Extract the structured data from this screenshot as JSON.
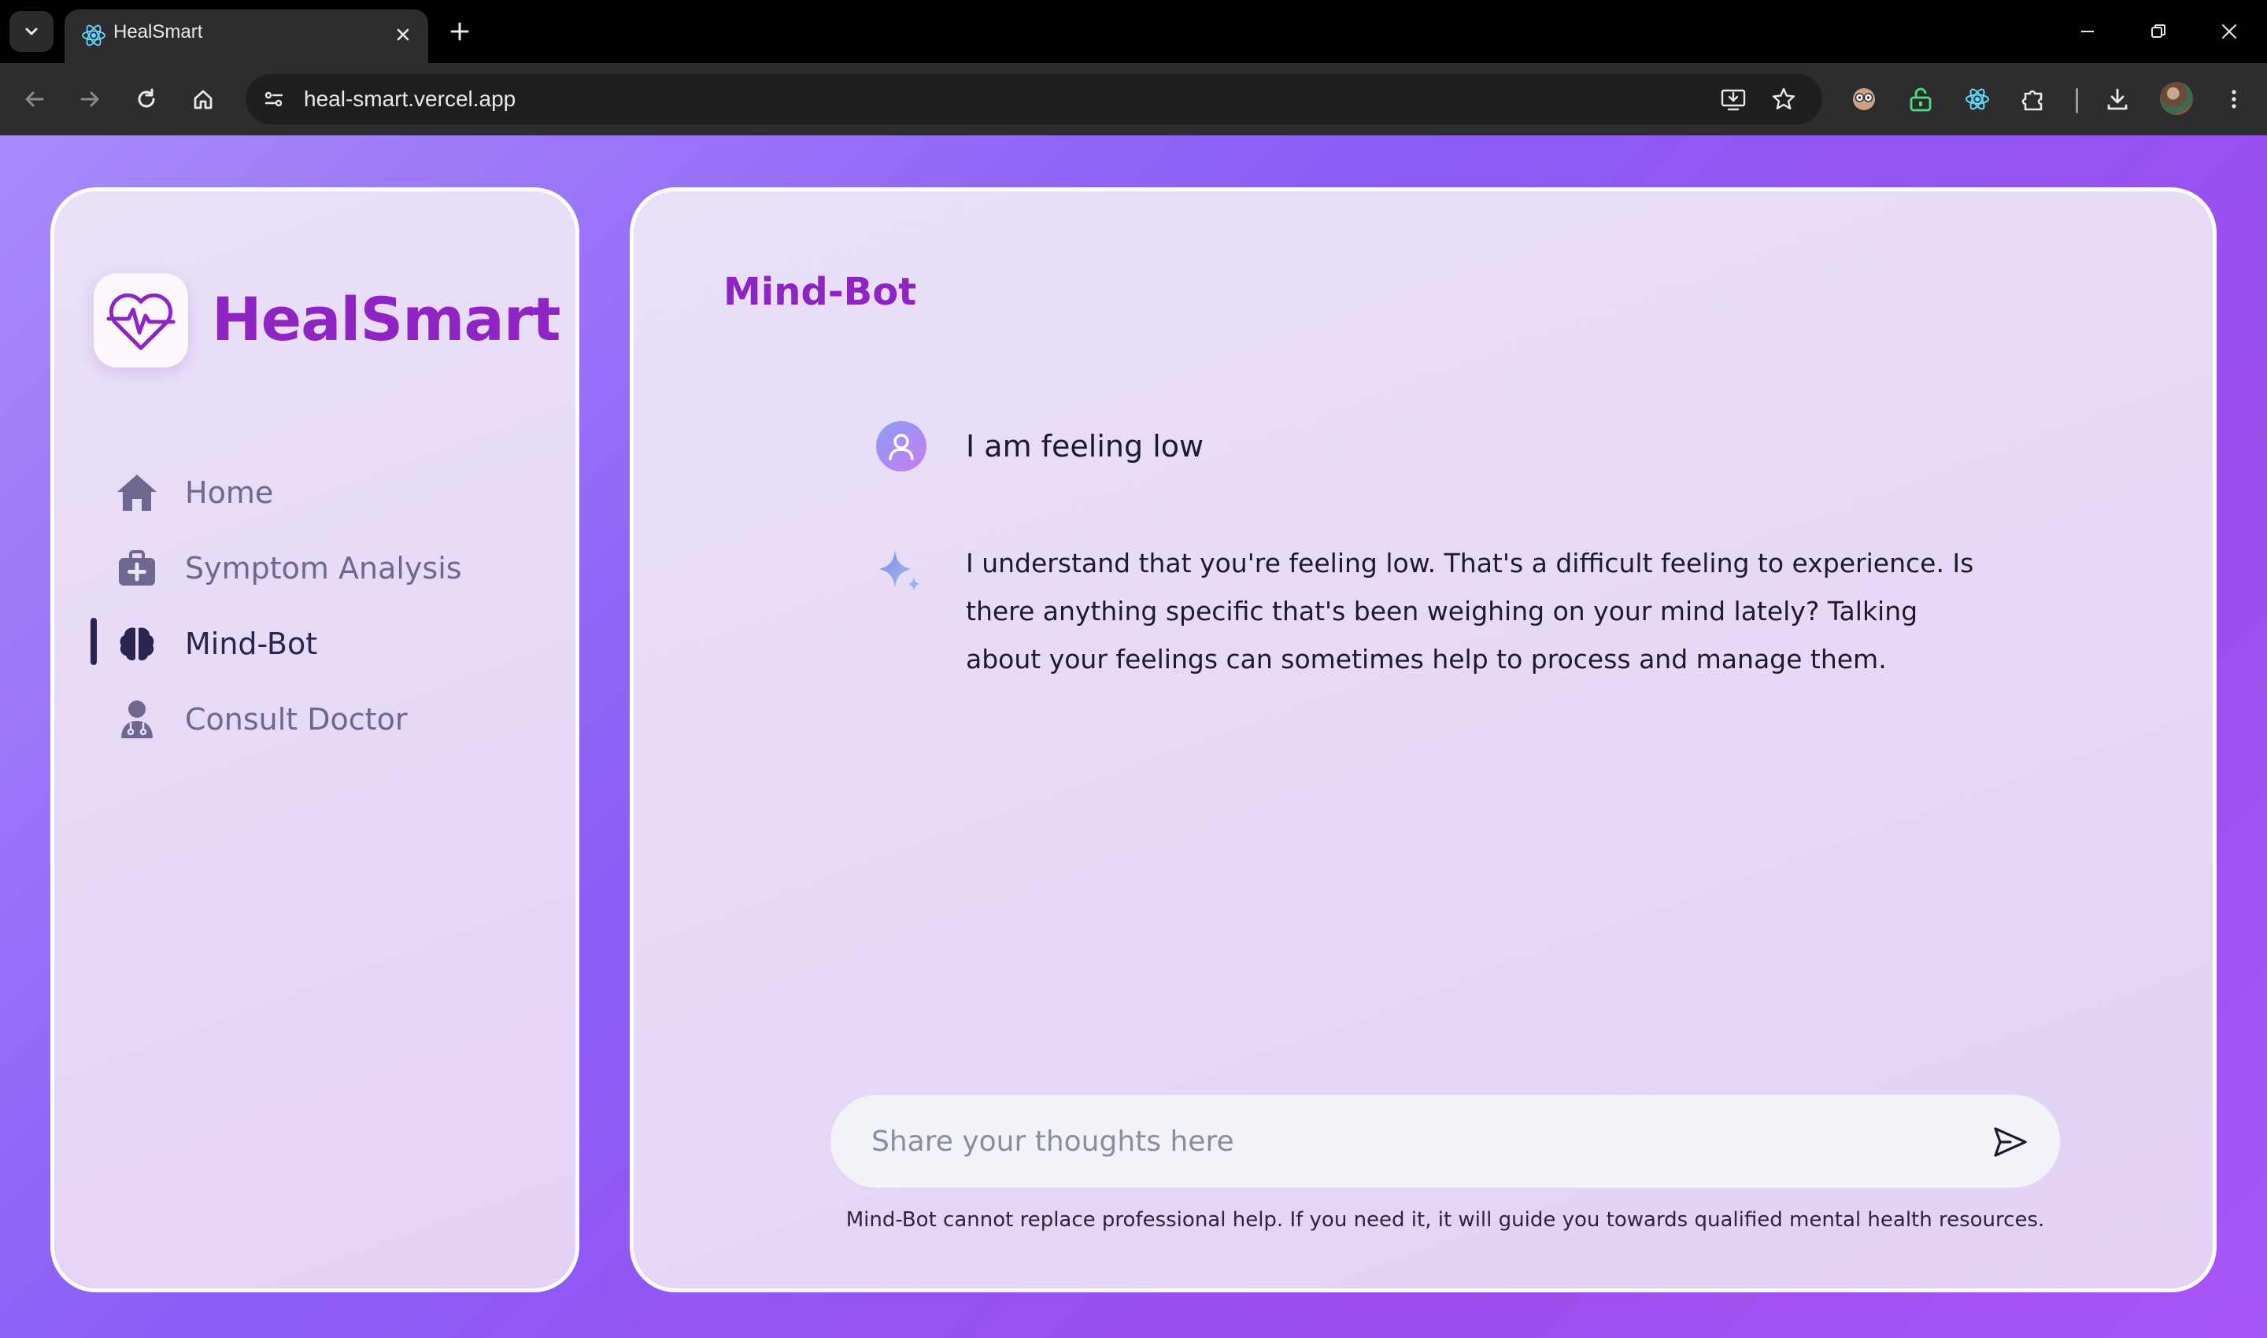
{
  "browser": {
    "tab_title": "HealSmart",
    "url": "heal-smart.vercel.app"
  },
  "app": {
    "brand": "HealSmart",
    "nav": [
      {
        "label": "Home",
        "icon": "home-icon",
        "active": false
      },
      {
        "label": "Symptom Analysis",
        "icon": "medical-kit-icon",
        "active": false
      },
      {
        "label": "Mind-Bot",
        "icon": "brain-icon",
        "active": true
      },
      {
        "label": "Consult Doctor",
        "icon": "doctor-icon",
        "active": false
      }
    ],
    "colors": {
      "brand": "#8e24c4",
      "active_text": "#2a2550",
      "muted_text": "#6e6790"
    }
  },
  "chat": {
    "title": "Mind-Bot",
    "messages": [
      {
        "role": "user",
        "text": "I am feeling low"
      },
      {
        "role": "bot",
        "text": "I understand that you're feeling low. That's a difficult feeling to experience. Is there anything specific that's been weighing on your mind lately? Talking about your feelings can sometimes help to process and manage them."
      }
    ],
    "input_placeholder": "Share your thoughts here",
    "disclaimer": "Mind-Bot cannot replace professional help. If you need it, it will guide you towards qualified mental health resources."
  }
}
